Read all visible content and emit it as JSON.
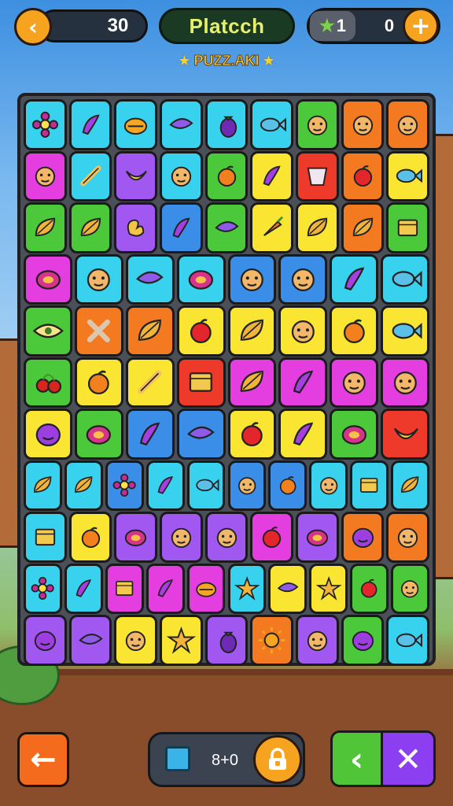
{
  "hud": {
    "score": "30",
    "title": "Platcch",
    "subtitle": "PUZZ.AKI",
    "stars": "1",
    "coins": "0"
  },
  "bottom": {
    "counter_text": "8+0"
  },
  "colors": {
    "cyan": "#38d2ef",
    "orange": "#f47a22",
    "green": "#4cc93a",
    "magenta": "#e43ee0",
    "purple": "#a058f0",
    "yellow": "#fbe533",
    "red": "#ee3a2a",
    "blue": "#3a8ee8"
  },
  "tiles": [
    {
      "c": "cyan",
      "icon": "flower"
    },
    {
      "c": "cyan",
      "icon": "pepper"
    },
    {
      "c": "cyan",
      "icon": "shell"
    },
    {
      "c": "cyan",
      "icon": "horn"
    },
    {
      "c": "cyan",
      "icon": "eggplant"
    },
    {
      "c": "cyan",
      "icon": "fish"
    },
    {
      "c": "green",
      "icon": "face"
    },
    {
      "c": "orange",
      "icon": "face"
    },
    {
      "c": "orange",
      "icon": "face"
    },
    {
      "c": "magenta",
      "icon": "face"
    },
    {
      "c": "cyan",
      "icon": "bone"
    },
    {
      "c": "purple",
      "icon": "banana"
    },
    {
      "c": "cyan",
      "icon": "face"
    },
    {
      "c": "green",
      "icon": "orange"
    },
    {
      "c": "yellow",
      "icon": "pepper"
    },
    {
      "c": "red",
      "icon": "cloth"
    },
    {
      "c": "orange",
      "icon": "apple"
    },
    {
      "c": "yellow",
      "icon": "fish"
    },
    {
      "c": "green",
      "icon": "leaf"
    },
    {
      "c": "green",
      "icon": "leaf"
    },
    {
      "c": "purple",
      "icon": "pretzel"
    },
    {
      "c": "blue",
      "icon": "pepper"
    },
    {
      "c": "green",
      "icon": "horn"
    },
    {
      "c": "yellow",
      "icon": "carrot"
    },
    {
      "c": "yellow",
      "icon": "leaf"
    },
    {
      "c": "orange",
      "icon": "leaf"
    },
    {
      "c": "green",
      "icon": "box"
    },
    {
      "c": "magenta",
      "icon": "berry"
    },
    {
      "c": "cyan",
      "icon": "face"
    },
    {
      "c": "cyan",
      "icon": "horn"
    },
    {
      "c": "cyan",
      "icon": "berry"
    },
    {
      "c": "blue",
      "icon": "face"
    },
    {
      "c": "blue",
      "icon": "face"
    },
    {
      "c": "cyan",
      "icon": "pepper"
    },
    {
      "c": "cyan",
      "icon": "fish"
    },
    {
      "c": "green",
      "icon": "eye"
    },
    {
      "c": "orange",
      "icon": "cross"
    },
    {
      "c": "orange",
      "icon": "leaf"
    },
    {
      "c": "yellow",
      "icon": "apple"
    },
    {
      "c": "yellow",
      "icon": "leaf"
    },
    {
      "c": "yellow",
      "icon": "face"
    },
    {
      "c": "yellow",
      "icon": "orange"
    },
    {
      "c": "yellow",
      "icon": "fish"
    },
    {
      "c": "green",
      "icon": "cherry"
    },
    {
      "c": "yellow",
      "icon": "orange"
    },
    {
      "c": "yellow",
      "icon": "bone"
    },
    {
      "c": "red",
      "icon": "box"
    },
    {
      "c": "magenta",
      "icon": "leaf"
    },
    {
      "c": "magenta",
      "icon": "pepper"
    },
    {
      "c": "magenta",
      "icon": "face"
    },
    {
      "c": "magenta",
      "icon": "face"
    },
    {
      "c": "yellow",
      "icon": "plum"
    },
    {
      "c": "green",
      "icon": "berry"
    },
    {
      "c": "blue",
      "icon": "pepper"
    },
    {
      "c": "blue",
      "icon": "horn"
    },
    {
      "c": "yellow",
      "icon": "apple"
    },
    {
      "c": "yellow",
      "icon": "pepper"
    },
    {
      "c": "green",
      "icon": "berry"
    },
    {
      "c": "red",
      "icon": "banana"
    },
    {
      "c": "cyan",
      "icon": "leaf"
    },
    {
      "c": "cyan",
      "icon": "leaf"
    },
    {
      "c": "blue",
      "icon": "flower"
    },
    {
      "c": "cyan",
      "icon": "pepper"
    },
    {
      "c": "cyan",
      "icon": "fish"
    },
    {
      "c": "blue",
      "icon": "face"
    },
    {
      "c": "blue",
      "icon": "orange"
    },
    {
      "c": "cyan",
      "icon": "face"
    },
    {
      "c": "cyan",
      "icon": "box"
    },
    {
      "c": "cyan",
      "icon": "leaf"
    },
    {
      "c": "cyan",
      "icon": "box"
    },
    {
      "c": "yellow",
      "icon": "orange"
    },
    {
      "c": "purple",
      "icon": "berry"
    },
    {
      "c": "purple",
      "icon": "face"
    },
    {
      "c": "purple",
      "icon": "face"
    },
    {
      "c": "magenta",
      "icon": "apple"
    },
    {
      "c": "purple",
      "icon": "berry"
    },
    {
      "c": "orange",
      "icon": "plum"
    },
    {
      "c": "orange",
      "icon": "face"
    },
    {
      "c": "cyan",
      "icon": "flower"
    },
    {
      "c": "cyan",
      "icon": "pepper"
    },
    {
      "c": "magenta",
      "icon": "box"
    },
    {
      "c": "magenta",
      "icon": "pepper"
    },
    {
      "c": "magenta",
      "icon": "shell"
    },
    {
      "c": "cyan",
      "icon": "star"
    },
    {
      "c": "yellow",
      "icon": "horn"
    },
    {
      "c": "yellow",
      "icon": "star"
    },
    {
      "c": "green",
      "icon": "apple"
    },
    {
      "c": "green",
      "icon": "face"
    },
    {
      "c": "purple",
      "icon": "plum"
    },
    {
      "c": "purple",
      "icon": "horn"
    },
    {
      "c": "yellow",
      "icon": "face"
    },
    {
      "c": "yellow",
      "icon": "star"
    },
    {
      "c": "purple",
      "icon": "eggplant"
    },
    {
      "c": "orange",
      "icon": "sun"
    },
    {
      "c": "purple",
      "icon": "face"
    },
    {
      "c": "green",
      "icon": "plum"
    },
    {
      "c": "cyan",
      "icon": "fish"
    }
  ]
}
